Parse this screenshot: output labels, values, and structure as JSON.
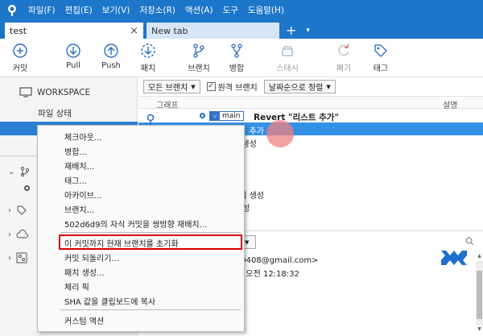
{
  "titlebar": {
    "menu": [
      "파일(F)",
      "편집(E)",
      "보기(V)",
      "저장소(R)",
      "액션(A)",
      "도구",
      "도움말(H)"
    ]
  },
  "tabs": [
    {
      "label": "test",
      "active": true,
      "close": "×"
    },
    {
      "label": "New tab",
      "active": false
    }
  ],
  "tab_add": "+",
  "tab_dropdown": "▾",
  "toolbar": {
    "commit": "커밋",
    "pull": "Pull",
    "push": "Push",
    "fetch": "패치",
    "branch": "브랜치",
    "merge": "병합",
    "stash": "스태시",
    "discard": "폐기",
    "tag": "태그"
  },
  "sidebar": {
    "workspace": "WORKSPACE",
    "file_status": "파일 상태"
  },
  "filter": {
    "all_branches": "모든 브랜치",
    "remote_branch": "원격 브랜치",
    "remote_checked": "✓",
    "sort": "날짜순으로 정렬"
  },
  "columns": {
    "graph": "그래프",
    "description": "설명"
  },
  "commits": {
    "head_branch": "main",
    "head_message": "Revert \"리스트 추가\"",
    "selected_fragment": "스트 추가",
    "frag_3": "일 생성",
    "frag_4": "이지 생성",
    "frag_5": "생성"
  },
  "details": {
    "email_fragment": "fl0408@gmail.com>",
    "date_fragment": "일 오전 12:18:32"
  },
  "context_menu": {
    "items": [
      "체크아웃...",
      "병합...",
      "재배치...",
      "태그...",
      "아카이브...",
      "브랜치...",
      "502d6d9의 자식 커밋을 쌍방향 재배치...",
      "이 커밋까지 현재 브랜치를 초기화",
      "커밋 되돌리기...",
      "패치 생성...",
      "체리 픽",
      "SHA 값을 클립보드에 복사",
      "커스텀 액션"
    ],
    "highlighted_index": 7
  },
  "colors": {
    "titlebar": "#1c76c9",
    "selection": "#3591e8",
    "highlight_border": "#d80000"
  }
}
